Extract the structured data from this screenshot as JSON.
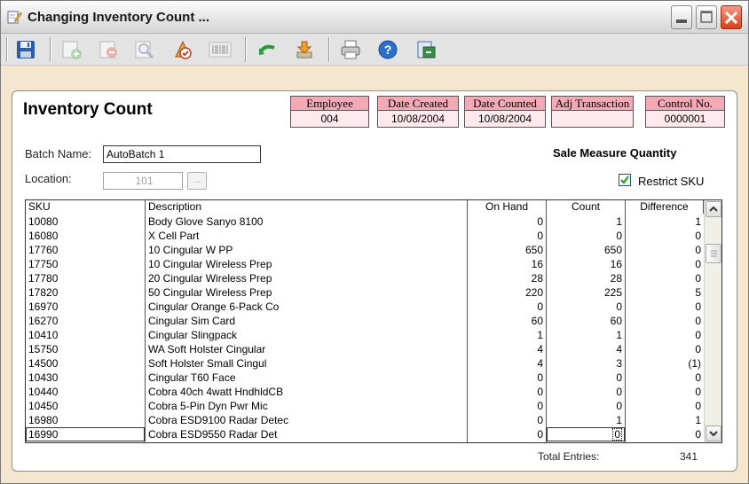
{
  "window": {
    "title": "Changing Inventory Count ...",
    "icon": "edit-document-icon"
  },
  "toolbar": {
    "buttons": [
      {
        "name": "save-icon",
        "enabled": true
      },
      {
        "name": "add-row-icon",
        "enabled": false
      },
      {
        "name": "delete-row-icon",
        "enabled": false
      },
      {
        "name": "find-icon",
        "enabled": false
      },
      {
        "name": "apply-icon",
        "enabled": true
      },
      {
        "name": "barcode-icon",
        "enabled": false
      },
      {
        "name": "undo-icon",
        "enabled": true
      },
      {
        "name": "import-icon",
        "enabled": true
      },
      {
        "name": "print-icon",
        "enabled": true
      },
      {
        "name": "help-icon",
        "enabled": true
      },
      {
        "name": "export-icon",
        "enabled": true
      }
    ]
  },
  "form": {
    "heading": "Inventory Count",
    "header_boxes": [
      {
        "label": "Employee",
        "value": "004"
      },
      {
        "label": "Date Created",
        "value": "10/08/2004"
      },
      {
        "label": "Date Counted",
        "value": "10/08/2004"
      },
      {
        "label": "Adj Transaction",
        "value": ""
      },
      {
        "label": "Control No.",
        "value": "0000001"
      }
    ],
    "batch_name_label": "Batch Name:",
    "batch_name_value": "AutoBatch 1",
    "location_label": "Location:",
    "location_value": "101",
    "location_lookup_label": "...",
    "sale_measure_label": "Sale Measure Quantity",
    "restrict_sku_label": "Restrict SKU",
    "restrict_sku_checked": true
  },
  "grid": {
    "columns": [
      "SKU",
      "Description",
      "On Hand",
      "Count",
      "Difference"
    ],
    "rows": [
      [
        "10080",
        "Body Glove Sanyo 8100",
        "0",
        "1",
        "1"
      ],
      [
        "16080",
        "X Cell Part",
        "0",
        "0",
        "0"
      ],
      [
        "17760",
        "10 Cingular  W PP",
        "650",
        "650",
        "0"
      ],
      [
        "17750",
        "10 Cingular Wireless Prep",
        "16",
        "16",
        "0"
      ],
      [
        "17780",
        "20 Cingular Wireless Prep",
        "28",
        "28",
        "0"
      ],
      [
        "17820",
        "50 Cingular Wireless Prep",
        "220",
        "225",
        "5"
      ],
      [
        "16970",
        "Cingular Orange 6-Pack Co",
        "0",
        "0",
        "0"
      ],
      [
        "16270",
        "Cingular Sim Card",
        "60",
        "60",
        "0"
      ],
      [
        "10410",
        "Cingular Slingpack",
        "1",
        "1",
        "0"
      ],
      [
        "15750",
        "WA Soft Holster Cingular",
        "4",
        "4",
        "0"
      ],
      [
        "14500",
        "Soft Holster Small Cingul",
        "4",
        "3",
        "(1)"
      ],
      [
        "10430",
        "Cingular T60 Face",
        "0",
        "0",
        "0"
      ],
      [
        "10440",
        "Cobra 40ch 4watt HndhldCB",
        "0",
        "0",
        "0"
      ],
      [
        "10450",
        "Cobra 5-Pin Dyn Pwr Mic",
        "0",
        "0",
        "0"
      ],
      [
        "16980",
        "Cobra ESD9100 Radar Detec",
        "0",
        "1",
        "1"
      ],
      [
        "16990",
        "Cobra ESD9550 Radar Det",
        "0",
        "0",
        "0"
      ]
    ],
    "scroll_position": 0.15
  },
  "footer": {
    "total_label": "Total Entries:",
    "total_value": "341"
  },
  "colors": {
    "window_bg": "#f5e6cf",
    "header_label_bg": "#f4a9b7",
    "header_value_bg": "#fde9ee"
  }
}
